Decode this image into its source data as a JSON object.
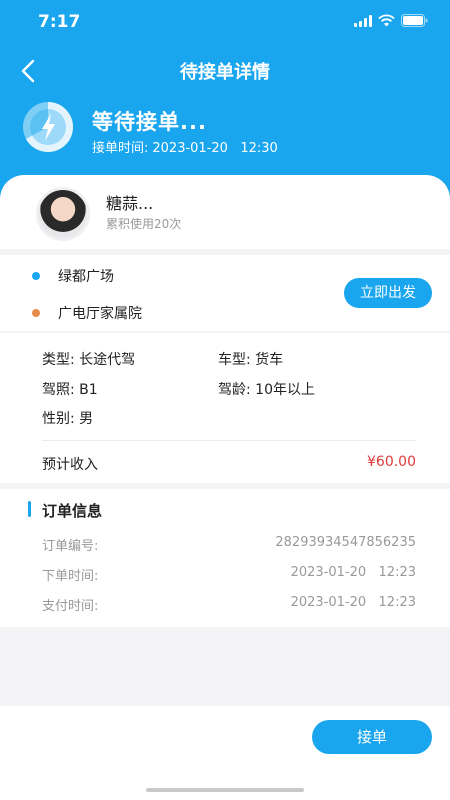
{
  "status_bar": {
    "time": "7:17"
  },
  "nav": {
    "title": "待接单详情"
  },
  "status": {
    "title": "等待接单...",
    "accept_time_label": "接单时间:",
    "accept_time_value": "2023-01-20   12:30"
  },
  "user": {
    "name": "糖蒜...",
    "usage": "累积使用20次"
  },
  "route": {
    "from": "绿都广场",
    "to": "广电厅家属院",
    "from_color": "#1aa6ef",
    "to_color": "#e98c4b",
    "depart_label": "立即出发"
  },
  "details": {
    "type_label": "类型:",
    "type_value": "长途代驾",
    "car_label": "车型:",
    "car_value": "货车",
    "license_label": "驾照:",
    "license_value": "B1",
    "age_label": "驾龄:",
    "age_value": "10年以上",
    "gender_label": "性别:",
    "gender_value": "男",
    "income_label": "预计收入",
    "income_value": "¥60.00"
  },
  "order": {
    "title": "订单信息",
    "rows": [
      {
        "label": "订单编号:",
        "value": "28293934547856235"
      },
      {
        "label": "下单时间:",
        "value": "2023-01-20   12:23"
      },
      {
        "label": "支付时间:",
        "value": "2023-01-20   12:23"
      }
    ]
  },
  "actions": {
    "accept_label": "接单"
  },
  "colors": {
    "accent": "#1aa6ef",
    "price": "#e23a3a"
  },
  "icons": [
    "back-arrow-icon",
    "lightning-icon",
    "signal-icon",
    "wifi-icon",
    "battery-icon"
  ]
}
